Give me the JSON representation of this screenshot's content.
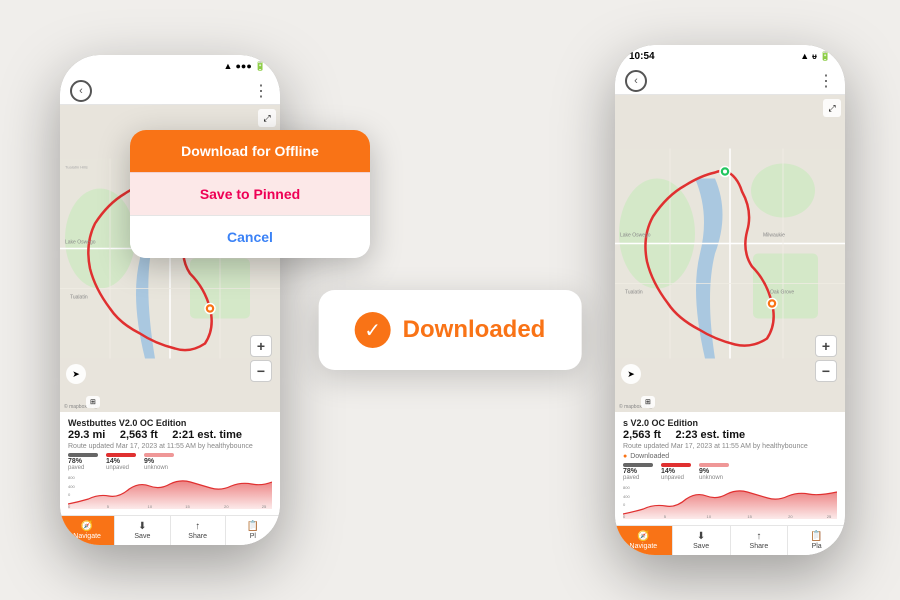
{
  "background_color": "#f0eeeb",
  "accent_color": "#f97316",
  "left_phone": {
    "nav": {
      "back_label": "‹",
      "menu_label": "⋮"
    },
    "route": {
      "title": "Westbuttes V2.0 OC Edition",
      "distance": "29.3 mi",
      "elevation": "2,563 ft",
      "time": "2:21 est. time",
      "updated": "Route updated Mar 17, 2023 at 11:55 AM by healthybounce",
      "surface": [
        {
          "pct": "78%",
          "label": "paved",
          "color": "#666"
        },
        {
          "pct": "14%",
          "label": "unpaved",
          "color": "#e03030"
        },
        {
          "pct": "9%",
          "label": "unknown",
          "color": "#e03030"
        }
      ]
    },
    "actions": [
      "Navigate",
      "Save",
      "Share",
      "Pl"
    ]
  },
  "right_phone": {
    "status_bar": {
      "time": "10:54",
      "icons": "▲ ᵾ 🔋"
    },
    "nav": {
      "back_label": "‹",
      "menu_label": "⋮"
    },
    "route": {
      "title": "s V2.0 OC Edition",
      "distance": "",
      "elevation": "2,563 ft",
      "time": "2:23 est. time",
      "updated": "Route updated Mar 17, 2023 at 11:55 AM by healthybounce",
      "downloaded_badge": "Downloaded",
      "surface": [
        {
          "pct": "78%",
          "label": "paved",
          "color": "#666"
        },
        {
          "pct": "14%",
          "label": "unpaved",
          "color": "#e03030"
        },
        {
          "pct": "9%",
          "label": "unknown",
          "color": "#e03030"
        }
      ]
    },
    "actions": [
      "Navigate",
      "Save",
      "Share",
      "Pla"
    ]
  },
  "download_popup": {
    "primary_label": "Download for Offline",
    "secondary_label": "Save to Pinned",
    "cancel_label": "Cancel"
  },
  "downloaded_toast": {
    "check_symbol": "✓",
    "label": "Downloaded"
  }
}
